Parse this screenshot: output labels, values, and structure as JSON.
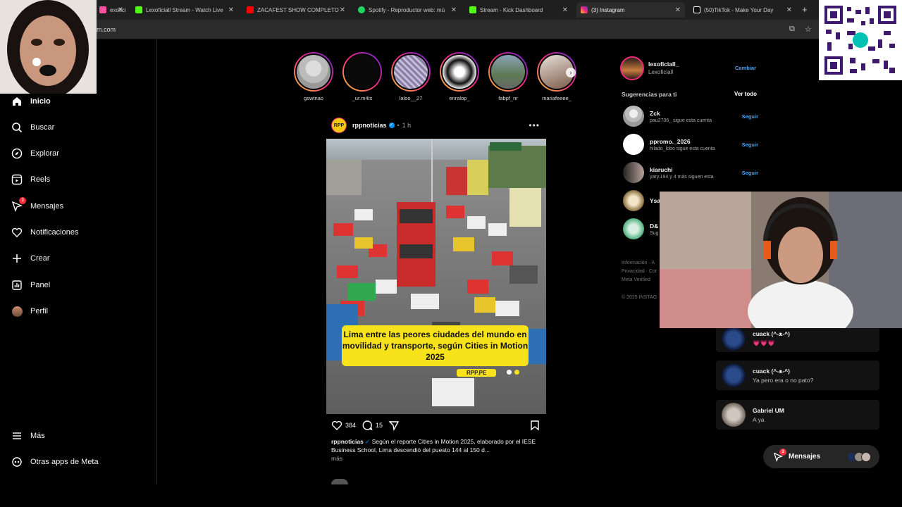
{
  "browser": {
    "tabs": [
      {
        "label": "exofici",
        "color": "#ff4fa3"
      },
      {
        "label": "Lexoficiall Stream - Watch Live",
        "color": "#53fc18"
      },
      {
        "label": "ZACAFEST SHOW COMPLETO",
        "color": "#ff0000"
      },
      {
        "label": "Spotify - Reproductor web: mú",
        "color": "#1ed760"
      },
      {
        "label": "Stream - Kick Dashboard",
        "color": "#53fc18"
      },
      {
        "label": "(3) Instagram",
        "color": "#e1306c"
      },
      {
        "label": "(50)TikTok - Make Your Day",
        "color": "#ffffff"
      }
    ],
    "url": "m.com"
  },
  "sidebar": {
    "items": [
      {
        "label": "Inicio",
        "icon": "home-icon"
      },
      {
        "label": "Buscar",
        "icon": "search-icon"
      },
      {
        "label": "Explorar",
        "icon": "compass-icon"
      },
      {
        "label": "Reels",
        "icon": "reels-icon"
      },
      {
        "label": "Mensajes",
        "icon": "messenger-icon",
        "badge": "3"
      },
      {
        "label": "Notificaciones",
        "icon": "heart-icon"
      },
      {
        "label": "Crear",
        "icon": "plus-icon"
      },
      {
        "label": "Panel",
        "icon": "dashboard-icon"
      },
      {
        "label": "Perfil",
        "icon": "avatar-icon"
      }
    ],
    "more": "Más",
    "meta_apps": "Otras apps de Meta"
  },
  "stories": [
    {
      "username": "gswtnao"
    },
    {
      "username": "_ur.m4ts"
    },
    {
      "username": "laloo__27"
    },
    {
      "username": "enralop_"
    },
    {
      "username": "fabpf_nr"
    },
    {
      "username": "mariafeeee_"
    }
  ],
  "post": {
    "username": "rppnoticias",
    "avatar_text": "RPP",
    "time": "1 h",
    "image_caption": "Lima entre las peores ciudades del mundo en movilidad y transporte, según Cities in Motion 2025",
    "image_tag": "RPP.PE",
    "likes": "384",
    "comments": "15",
    "caption_user": "rppnoticias",
    "caption_text": "Según el reporte Cities in Motion 2025, elaborado por el IESE Business School, Lima descendió del puesto 144 al 150 d...",
    "more": "más"
  },
  "profile": {
    "username": "lexoficiall_",
    "name": "Lexoficiall",
    "switch": "Cambiar"
  },
  "suggestions": {
    "title": "Sugerencias para ti",
    "see_all": "Ver todo",
    "items": [
      {
        "name": "Zck",
        "sub": "pau2706_ sigue esta cuenta",
        "follow": "Seguir"
      },
      {
        "name": "ppromo._2026",
        "sub": "hilado_lobo sigue esta cuenta",
        "follow": "Seguir"
      },
      {
        "name": "kiaruchi",
        "sub": "yary.194 y 4 más siguen esta",
        "follow": "Seguir"
      },
      {
        "name": "Ysa",
        "sub": "",
        "follow": ""
      },
      {
        "name": "D&",
        "sub": "Sug",
        "follow": ""
      }
    ]
  },
  "footer": {
    "line1": "Información · A",
    "line2": "Privacidad · Cor",
    "line3": "Meta Verified",
    "copyright": "© 2025 INSTAG"
  },
  "chats": [
    {
      "name": "cuack (^-ᴥ-^)",
      "message": "💗💗💗"
    },
    {
      "name": "cuack (^-ᴥ-^)",
      "message": "Ya pero era o no pato?"
    },
    {
      "name": "Gabriel UM",
      "message": "A ya"
    }
  ],
  "messages_pill": {
    "label": "Mensajes",
    "badge": "3"
  }
}
